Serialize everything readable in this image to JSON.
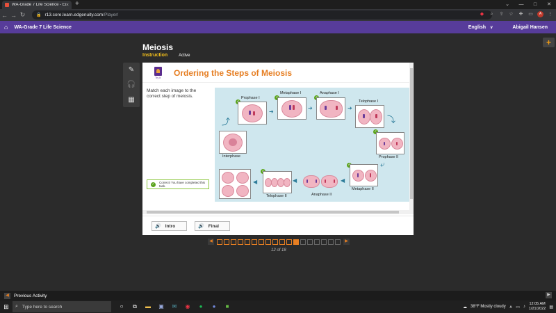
{
  "browser": {
    "tab_title": "WA-Grade 7 Life Science - Edgen",
    "tab_close": "×",
    "new_tab": "+",
    "url_host": "r13.core.learn.edgenuity.com",
    "url_path": "/Player/",
    "window_controls": [
      "⌄",
      "—",
      "□",
      "✕"
    ]
  },
  "app": {
    "home": "⌂",
    "course": "WA-Grade 7 Life Science",
    "language": "English",
    "user": "Abigail Hansen",
    "plus": "+"
  },
  "lesson": {
    "title": "Meiosis",
    "tab_instruction": "Instruction",
    "status": "Active"
  },
  "tools": {
    "pencil": "✎",
    "headphones": "🎧",
    "calculator": "▦"
  },
  "activity": {
    "logo_text": "Try it",
    "title": "Ordering the Steps of Meiosis",
    "prompt": "Match each image to the correct step of meiosis.",
    "feedback": "Correct! You have completed this task.",
    "labels": {
      "prophase1": "Prophase I",
      "metaphase1": "Metaphase I",
      "anaphase1": "Anaphase I",
      "telophase1": "Telophase I",
      "interphase": "Interphase",
      "prophase2": "Prophase II",
      "metaphase2": "Metaphase II",
      "anaphase2": "Anaphase II",
      "telophase2": "Telophase II"
    },
    "buttons": {
      "intro": "Intro",
      "final": "Final"
    }
  },
  "pager": {
    "prev": "◀",
    "next": "▶",
    "total_pages": 18,
    "current_page": 12,
    "count_label": "12 of 18"
  },
  "footer": {
    "previous_activity": "Previous Activity",
    "prev_arrow": "◀",
    "next_arrow": "▶"
  },
  "taskbar": {
    "search_placeholder": "Type here to search",
    "weather": "38°F  Mostly cloudy",
    "time": "12:05 AM",
    "date": "1/21/2022"
  }
}
